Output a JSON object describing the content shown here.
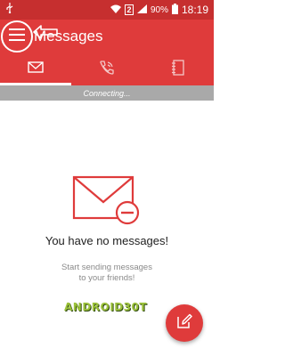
{
  "colors": {
    "status_bar": "#c62f2f",
    "accent": "#df3b3b",
    "connect_bar": "#a9a9a9",
    "watermark": "#9cc23b"
  },
  "status_bar": {
    "sim_slot": "2",
    "battery": "90%",
    "time": "18:19",
    "icons": [
      "usb-icon",
      "wifi-icon",
      "sim-icon",
      "signal-icon",
      "battery-icon"
    ]
  },
  "app_bar": {
    "title": "Messages",
    "menu_icon": "hamburger-menu-icon"
  },
  "tabs": [
    {
      "icon": "envelope-icon",
      "active": true
    },
    {
      "icon": "phone-call-icon",
      "active": false
    },
    {
      "icon": "contacts-book-icon",
      "active": false
    }
  ],
  "connection_status": "Connecting...",
  "empty_state": {
    "icon": "envelope-minus-icon",
    "title": "You have no messages!",
    "subtitle_line1": "Start sending messages",
    "subtitle_line2": "to your friends!"
  },
  "watermark": "ANDROID30T",
  "fab": {
    "icon": "compose-icon"
  }
}
